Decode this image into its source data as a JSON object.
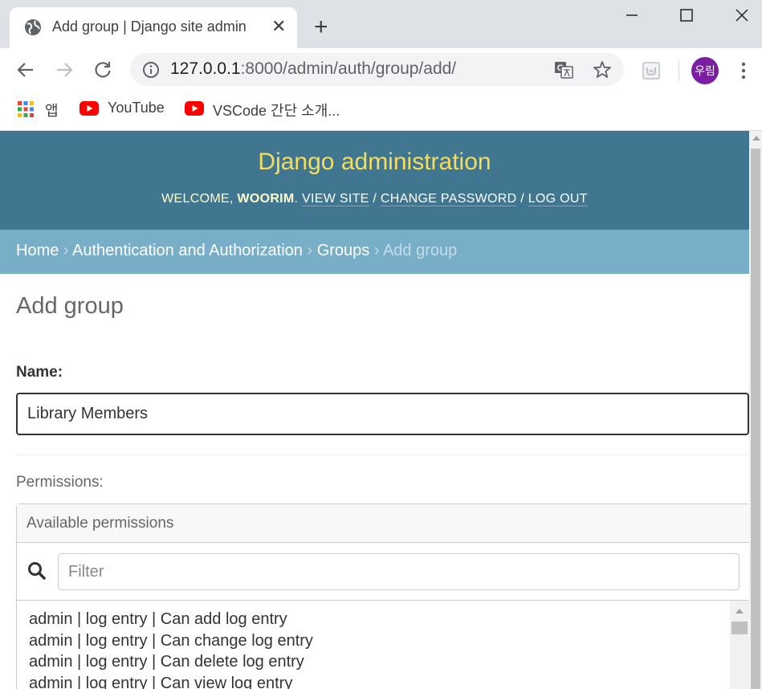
{
  "browser": {
    "tab_title": "Add group | Django site admin",
    "url_host": "127.0.0.1",
    "url_rest": ":8000/admin/auth/group/add/",
    "avatar_text": "우림",
    "avatar_color": "#7b1fa2",
    "bookmarks": [
      {
        "label": "앱",
        "icon": "apps-grid-icon"
      },
      {
        "label": "YouTube",
        "icon": "youtube-icon"
      },
      {
        "label": "VSCode 간단 소개...",
        "icon": "youtube-icon"
      }
    ]
  },
  "header": {
    "branding": "Django administration",
    "welcome": "WELCOME, ",
    "username": "WOORIM",
    "user_suffix": ". ",
    "view_site": "VIEW SITE",
    "change_password": "CHANGE PASSWORD",
    "log_out": "LOG OUT",
    "separator": " / "
  },
  "breadcrumbs": {
    "home": "Home",
    "app": "Authentication and Authorization",
    "model": "Groups",
    "current": "Add group",
    "separator": " › "
  },
  "form": {
    "title": "Add group",
    "name_label": "Name:",
    "name_value": "Library Members",
    "permissions_label": "Permissions:",
    "available_title": "Available permissions",
    "filter_placeholder": "Filter",
    "permissions": [
      "admin | log entry | Can add log entry",
      "admin | log entry | Can change log entry",
      "admin | log entry | Can delete log entry",
      "admin | log entry | Can view log entry"
    ]
  },
  "colors": {
    "header_bg": "#417690",
    "branding": "#f5dd5d",
    "breadcrumbs_bg": "#79aec8"
  }
}
